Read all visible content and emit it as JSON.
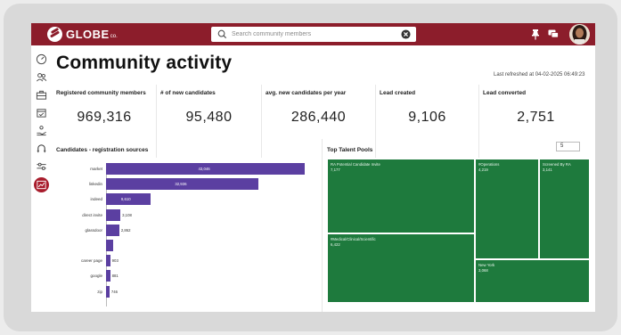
{
  "header": {
    "logo_text": "GLOBE",
    "logo_suffix": "co.",
    "search_placeholder": "Search community members"
  },
  "page": {
    "title": "Community activity",
    "last_refreshed": "Last refreshed at 04-02-2025 06:49:23"
  },
  "kpis": [
    {
      "label": "Registered community members",
      "value": "969,316"
    },
    {
      "label": "# of new candidates",
      "value": "95,480"
    },
    {
      "label": "avg. new candidates per year",
      "value": "286,440"
    },
    {
      "label": "Lead created",
      "value": "9,106"
    },
    {
      "label": "Lead converted",
      "value": "2,751"
    }
  ],
  "registration_sources": {
    "title": "Candidates - registration sources",
    "chart_data": {
      "type": "bar",
      "orientation": "horizontal",
      "categories": [
        "market",
        "linkedin",
        "indeed",
        "direct invite",
        "glassdoor",
        "",
        "career page",
        "google",
        "zip"
      ],
      "values": [
        43046,
        32936,
        9610,
        3108,
        2862,
        1624,
        903,
        881,
        746
      ],
      "value_labels": [
        "43,046",
        "32,936",
        "9,610",
        "3,108",
        "2,862",
        "",
        "903",
        "881",
        "746"
      ],
      "color": "#5b3fa1"
    }
  },
  "talent_pools": {
    "title": "Top Talent Pools",
    "top_n": "5",
    "chart_data": {
      "type": "treemap",
      "items": [
        {
          "label": "RA Potential Candidate Invite",
          "value": 7177,
          "value_label": "7,177"
        },
        {
          "label": "#Medical/Clinical/Scientific",
          "value": 6422,
          "value_label": "6,422"
        },
        {
          "label": "#Operations",
          "value": 4219,
          "value_label": "4,219"
        },
        {
          "label": "Screened By RA",
          "value": 3141,
          "value_label": "3,141"
        },
        {
          "label": "New York",
          "value": 3068,
          "value_label": "3,068"
        }
      ],
      "color": "#1e7a3d"
    }
  },
  "colors": {
    "brand": "#8c1d2b",
    "bar": "#5b3fa1",
    "treemap": "#1e7a3d"
  }
}
